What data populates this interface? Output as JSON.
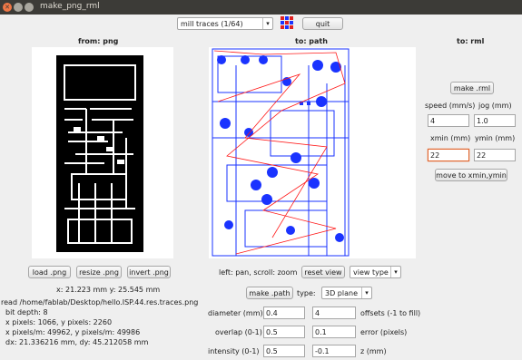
{
  "window": {
    "title": "make_png_rml",
    "close_glyph": "✕"
  },
  "toolbar": {
    "format_select": "mill traces (1/64)",
    "quit_label": "quit"
  },
  "columns": {
    "from": "from: png",
    "to_path": "to: path",
    "to_rml": "to: rml"
  },
  "png_buttons": {
    "load": "load .png",
    "resize": "resize .png",
    "invert": "invert .png"
  },
  "png_info": {
    "size": "x: 21.223 mm y: 25.545 mm",
    "read": "read /home/fablab/Desktop/hello.ISP.44.res.traces.png",
    "depth": "bit depth: 8",
    "pixels": "x pixels: 1066, y pixels: 2260",
    "ppm": "x pixels/m: 49962, y pixels/m: 49986",
    "dxdy": "dx: 21.336216 mm, dy: 45.212058 mm"
  },
  "path_controls": {
    "hint": "left: pan, scroll: zoom",
    "reset_view": "reset view",
    "view_type": "view type",
    "make_path": "make .path",
    "type_label": "type:",
    "type_value": "3D plane"
  },
  "params": {
    "diameter_label": "diameter (mm)",
    "diameter": "0.4",
    "offsets_value": "4",
    "offsets_label": "offsets (-1 to fill)",
    "overlap_label": "overlap (0-1)",
    "overlap": "0.5",
    "error_value": "0.1",
    "error_label": "error (pixels)",
    "intensity_label": "intensity (0-1)",
    "intensity": "0.5",
    "z_value": "-0.1",
    "z_label": "z (mm)"
  },
  "rml": {
    "make_rml": "make .rml",
    "speed_label": "speed (mm/s)",
    "jog_label": "jog (mm)",
    "speed": "4",
    "jog": "1.0",
    "xmin_label": "xmin (mm)",
    "ymin_label": "ymin (mm)",
    "xmin": "22",
    "ymin": "22",
    "move": "move to xmin,ymin"
  },
  "colors": {
    "path_blue": "#1a33ff",
    "path_red": "#ff1a1a",
    "accent_error": "#e1652e"
  }
}
